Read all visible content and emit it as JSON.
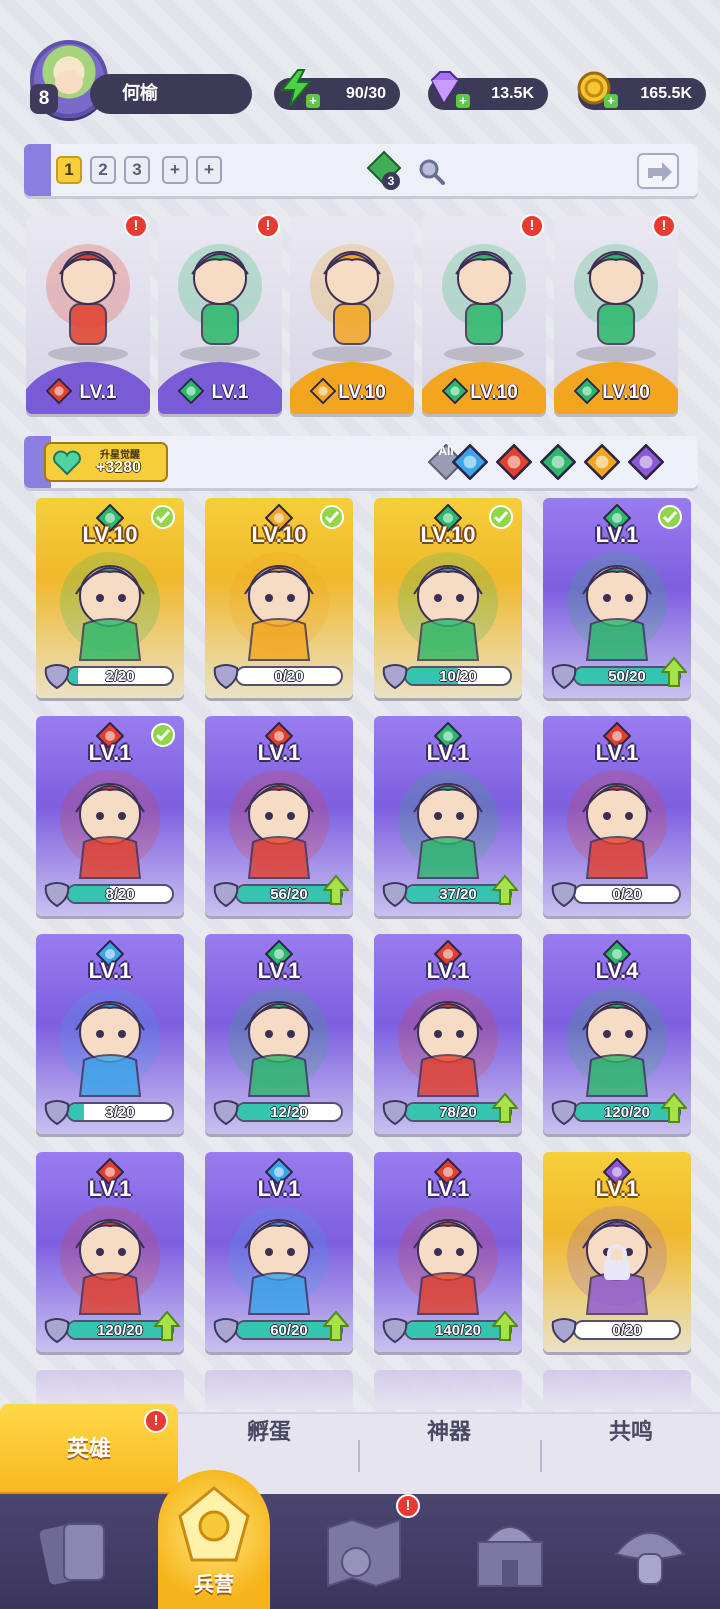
{
  "player": {
    "level": "8",
    "name": "何榆"
  },
  "resources": {
    "energy": "90/30",
    "gems": "13.5K",
    "coins": "165.5K"
  },
  "team_bar": {
    "tabs": [
      "1",
      "2",
      "3",
      "+",
      "+"
    ],
    "badge_count": "3"
  },
  "lineup": [
    {
      "element": "fire",
      "level": "LV.1",
      "style": "purple",
      "alert": "!"
    },
    {
      "element": "wind",
      "level": "LV.1",
      "style": "purple",
      "alert": "!"
    },
    {
      "element": "light",
      "level": "LV.10",
      "style": "gold",
      "alert": ""
    },
    {
      "element": "wind",
      "level": "LV.10",
      "style": "gold",
      "alert": "!"
    },
    {
      "element": "wind",
      "level": "LV.10",
      "style": "gold",
      "alert": "!"
    }
  ],
  "awaken": {
    "title": "升星觉醒",
    "value": "+3280"
  },
  "filters": {
    "all_label": "All",
    "elements": [
      "water",
      "fire",
      "wind",
      "light",
      "dark"
    ]
  },
  "heroes": [
    {
      "element": "wind",
      "level": "LV.10",
      "style": "gold",
      "checked": true,
      "shards": "2/20",
      "progress": 0.1,
      "upgrade": false,
      "locked": false
    },
    {
      "element": "light",
      "level": "LV.10",
      "style": "gold",
      "checked": true,
      "shards": "0/20",
      "progress": 0,
      "upgrade": false,
      "locked": false
    },
    {
      "element": "wind",
      "level": "LV.10",
      "style": "gold",
      "checked": true,
      "shards": "10/20",
      "progress": 0.5,
      "upgrade": false,
      "locked": false
    },
    {
      "element": "wind",
      "level": "LV.1",
      "style": "purple",
      "checked": true,
      "shards": "50/20",
      "progress": 1,
      "upgrade": true,
      "locked": false
    },
    {
      "element": "fire",
      "level": "LV.1",
      "style": "purple",
      "checked": true,
      "shards": "8/20",
      "progress": 0.4,
      "upgrade": false,
      "locked": false
    },
    {
      "element": "fire",
      "level": "LV.1",
      "style": "purple",
      "checked": false,
      "shards": "56/20",
      "progress": 1,
      "upgrade": true,
      "locked": false
    },
    {
      "element": "wind",
      "level": "LV.1",
      "style": "purple",
      "checked": false,
      "shards": "37/20",
      "progress": 1,
      "upgrade": true,
      "locked": false
    },
    {
      "element": "fire",
      "level": "LV.1",
      "style": "purple",
      "checked": false,
      "shards": "0/20",
      "progress": 0,
      "upgrade": false,
      "locked": false
    },
    {
      "element": "water",
      "level": "LV.1",
      "style": "purple",
      "checked": false,
      "shards": "3/20",
      "progress": 0.15,
      "upgrade": false,
      "locked": false
    },
    {
      "element": "wind",
      "level": "LV.1",
      "style": "purple",
      "checked": false,
      "shards": "12/20",
      "progress": 0.6,
      "upgrade": false,
      "locked": false
    },
    {
      "element": "fire",
      "level": "LV.1",
      "style": "purple",
      "checked": false,
      "shards": "78/20",
      "progress": 1,
      "upgrade": true,
      "locked": false
    },
    {
      "element": "wind",
      "level": "LV.4",
      "style": "purple",
      "checked": false,
      "shards": "120/20",
      "progress": 1,
      "upgrade": true,
      "locked": false
    },
    {
      "element": "fire",
      "level": "LV.1",
      "style": "purple",
      "checked": false,
      "shards": "120/20",
      "progress": 1,
      "upgrade": true,
      "locked": false
    },
    {
      "element": "water",
      "level": "LV.1",
      "style": "purple",
      "checked": false,
      "shards": "60/20",
      "progress": 1,
      "upgrade": true,
      "locked": false
    },
    {
      "element": "fire",
      "level": "LV.1",
      "style": "purple",
      "checked": false,
      "shards": "140/20",
      "progress": 1,
      "upgrade": true,
      "locked": false
    },
    {
      "element": "dark",
      "level": "LV.1",
      "style": "gold",
      "checked": false,
      "shards": "0/20",
      "progress": 0,
      "upgrade": false,
      "locked": true
    }
  ],
  "sub_tabs": {
    "heroes": "英雄",
    "hatch": "孵蛋",
    "artifact": "神器",
    "resonance": "共鸣",
    "alert": "!"
  },
  "nav": {
    "barracks": "兵营",
    "alert": "!"
  },
  "colors": {
    "fire": "#e2402c",
    "wind": "#2bb86a",
    "light": "#f2a620",
    "water": "#3aa5e8",
    "dark": "#8d57d6",
    "accent": "#f6cd3a",
    "navbar": "#3c365e"
  }
}
